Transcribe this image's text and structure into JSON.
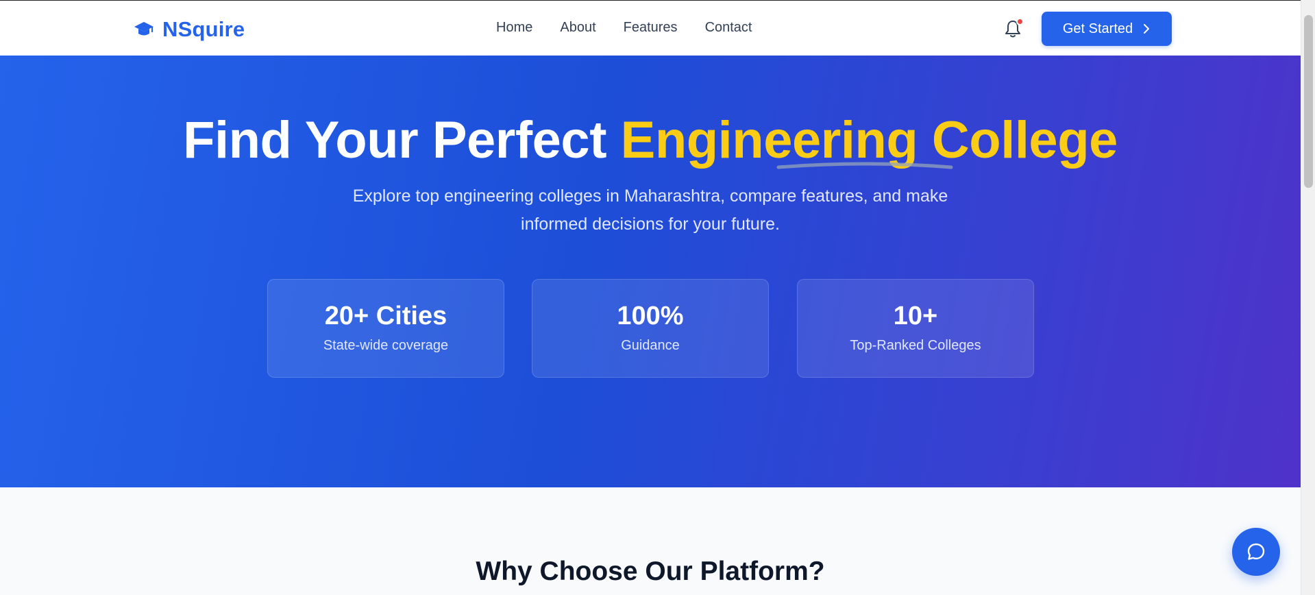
{
  "brand": {
    "name": "NSquire",
    "icon": "graduation-cap-icon"
  },
  "nav": {
    "items": [
      {
        "label": "Home"
      },
      {
        "label": "About"
      },
      {
        "label": "Features"
      },
      {
        "label": "Contact"
      }
    ]
  },
  "header": {
    "notification_icon": "bell-icon",
    "has_unread": true,
    "cta_label": "Get Started",
    "cta_icon": "chevron-right-icon"
  },
  "hero": {
    "title_plain": "Find Your Perfect ",
    "title_accent": "Engineering College",
    "subtitle": "Explore top engineering colleges in Maharashtra, compare features, and make informed decisions for your future.",
    "stats": [
      {
        "value": "20+ Cities",
        "label": "State-wide coverage"
      },
      {
        "value": "100%",
        "label": "Guidance"
      },
      {
        "value": "10+",
        "label": "Top-Ranked Colleges"
      }
    ]
  },
  "section": {
    "title": "Why Choose Our Platform?"
  },
  "chat": {
    "icon": "chat-bubble-icon"
  },
  "colors": {
    "primary": "#2563eb",
    "accent": "#facc15",
    "hero_gradient_start": "#2563eb",
    "hero_gradient_end": "#4f32c9",
    "notification": "#ef4444"
  }
}
